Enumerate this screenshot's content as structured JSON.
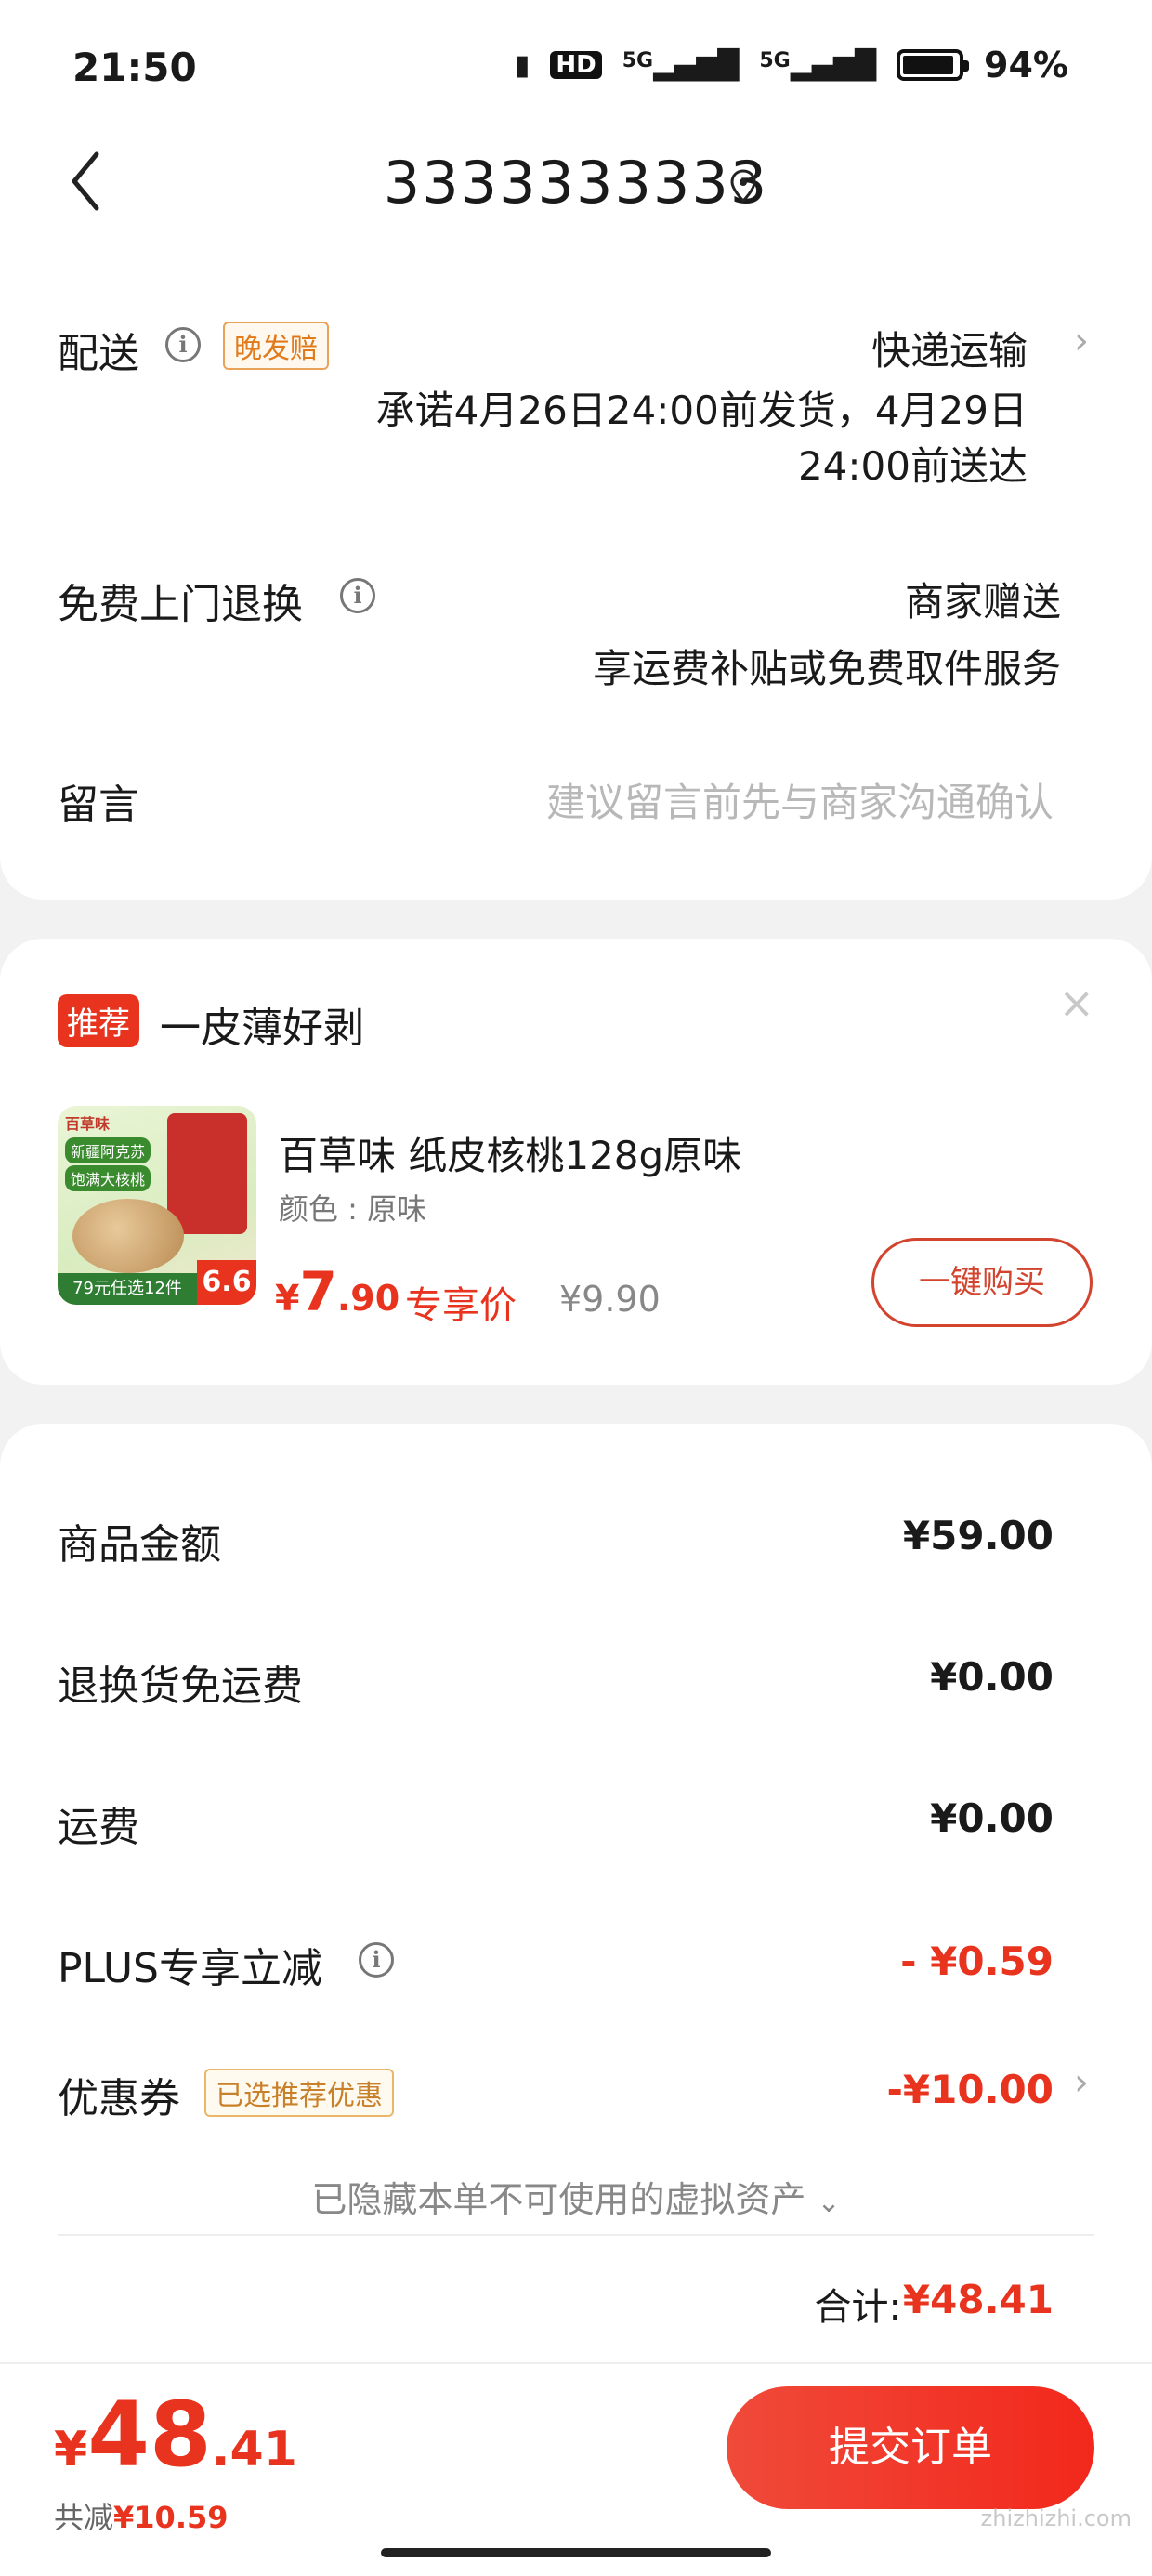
{
  "status_bar": {
    "time": "21:50",
    "icons": [
      "vibrate-icon",
      "hd-icon",
      "signal-5g-icon",
      "signal-5g-icon",
      "battery-icon"
    ],
    "hd_label": "HD",
    "net1": "5G",
    "net2": "5G",
    "battery": "94%"
  },
  "nav": {
    "title": "3333333333",
    "back_icon": "back-chevron-icon",
    "location_icon": "location-pin-icon"
  },
  "delivery": {
    "label": "配送",
    "tag": "晚发赔",
    "method": "快递运输",
    "line1": "承诺4月26日24:00前发货，4月29日",
    "line2": "24:00前送达"
  },
  "return": {
    "label": "免费上门退换",
    "title": "商家赠送",
    "desc": "享运费补贴或免费取件服务"
  },
  "message": {
    "label": "留言",
    "placeholder": "建议留言前先与商家沟通确认"
  },
  "recommend": {
    "tag": "推荐",
    "title": "一皮薄好剥",
    "product": {
      "name": "百草味 纸皮核桃128g原味",
      "spec": "颜色 : 原味",
      "price_symbol": "¥",
      "price_int": "7",
      "price_dec": ".90",
      "price_label": "专享价",
      "orig_price": "¥9.90",
      "img_badge_top1": "新疆阿克苏",
      "img_badge_top2": "饱满大核桃",
      "img_bottom_text": "79元任选12件",
      "img_bottom_price": "6.6",
      "img_logo": "百草味"
    },
    "buy_label": "一键购买"
  },
  "summary": {
    "rows": [
      {
        "label": "商品金额",
        "value": "¥59.00"
      },
      {
        "label": "退换货免运费",
        "value": "¥0.00"
      },
      {
        "label": "运费",
        "value": "¥0.00"
      },
      {
        "label": "PLUS专享立减",
        "value": "- ¥0.59"
      },
      {
        "label": "优惠券",
        "value": "-¥10.00"
      }
    ],
    "coupon_tag": "已选推荐优惠",
    "hidden_note": "已隐藏本单不可使用的虚拟资产",
    "total_label": "合计:",
    "total_value": "¥48.41"
  },
  "bottom": {
    "price_symbol": "¥",
    "price_int": "48",
    "price_dec": ".41",
    "saved_label": "共减",
    "saved_value": "¥10.59",
    "submit_label": "提交订单"
  },
  "watermark": {
    "text": "zhizhizhi.com"
  },
  "colors": {
    "accent": "#e8341e",
    "tag_orange": "#e07a1a",
    "background": "#f2f2f2"
  }
}
